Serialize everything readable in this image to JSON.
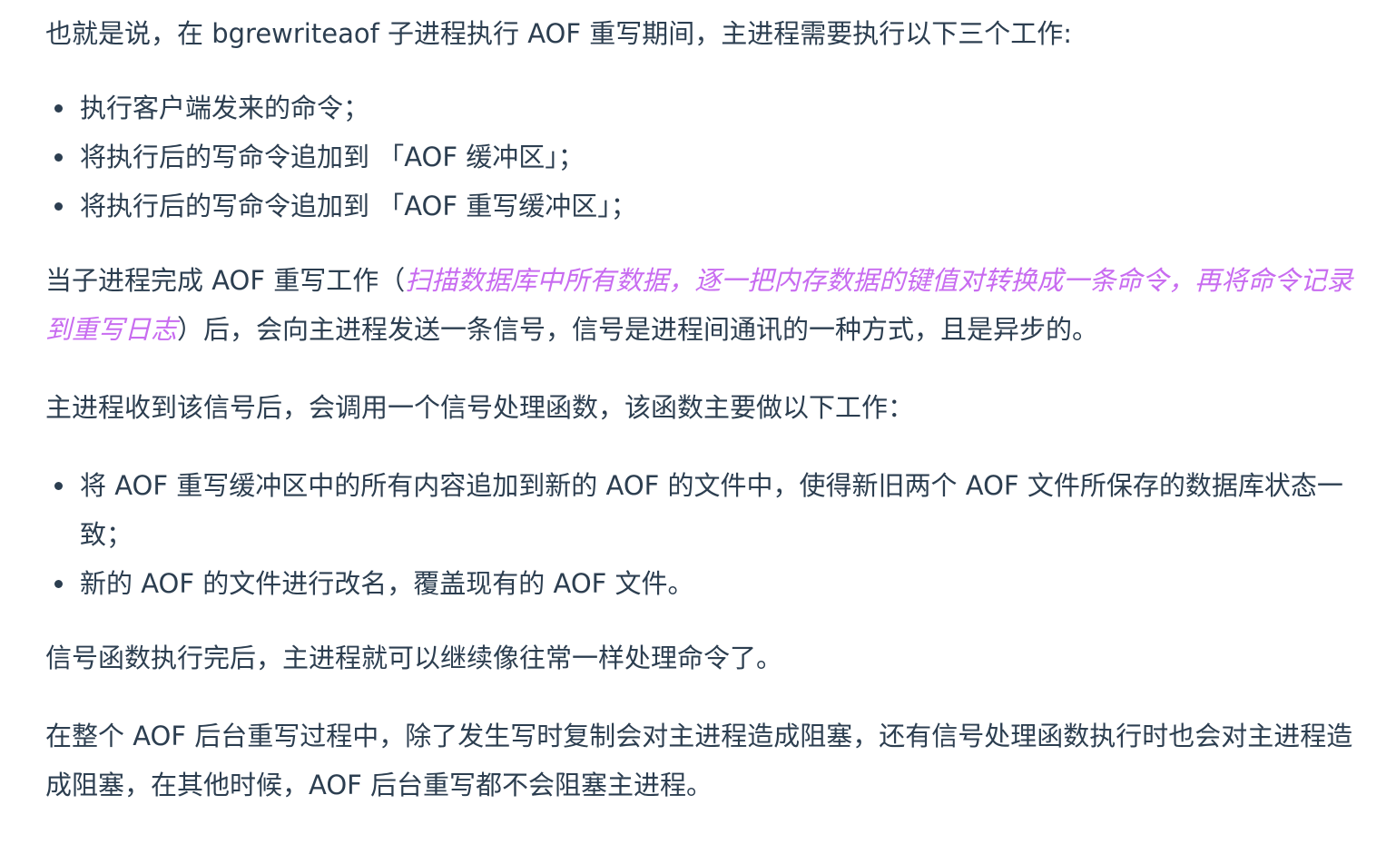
{
  "article": {
    "intro": "也就是说，在 bgrewriteaof 子进程执行 AOF 重写期间，主进程需要执行以下三个工作:",
    "list1": [
      "执行客户端发来的命令；",
      "将执行后的写命令追加到 「AOF 缓冲区」；",
      "将执行后的写命令追加到 「AOF 重写缓冲区」；"
    ],
    "para2": {
      "before": "当子进程完成 AOF 重写工作（",
      "emphasis": "扫描数据库中所有数据，逐一把内存数据的键值对转换成一条命令，再将命令记录到重写日志",
      "after": "）后，会向主进程发送一条信号，信号是进程间通讯的一种方式，且是异步的。"
    },
    "para3": "主进程收到该信号后，会调用一个信号处理函数，该函数主要做以下工作：",
    "list2": [
      "将 AOF 重写缓冲区中的所有内容追加到新的 AOF 的文件中，使得新旧两个 AOF 文件所保存的数据库状态一致；",
      "新的 AOF 的文件进行改名，覆盖现有的 AOF 文件。"
    ],
    "para4": "信号函数执行完后，主进程就可以继续像往常一样处理命令了。",
    "para5": "在整个 AOF 后台重写过程中，除了发生写时复制会对主进程造成阻塞，还有信号处理函数执行时也会对主进程造成阻塞，在其他时候，AOF 后台重写都不会阻塞主进程。"
  },
  "colors": {
    "text": "#2c3e50",
    "emphasis": "#c86cf0",
    "background": "#ffffff"
  }
}
